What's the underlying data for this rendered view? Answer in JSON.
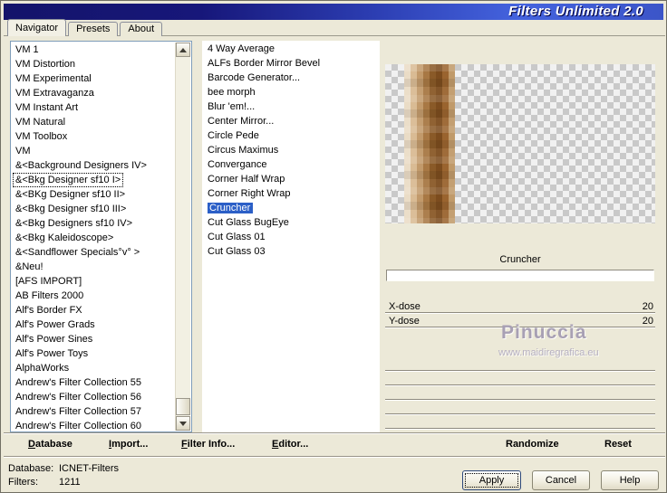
{
  "window": {
    "title": "Filters Unlimited 2.0"
  },
  "tabs": {
    "items": [
      "Navigator",
      "Presets",
      "About"
    ],
    "active_index": 0
  },
  "navigator": {
    "categories": [
      "VM 1",
      "VM Distortion",
      "VM Experimental",
      "VM Extravaganza",
      "VM Instant Art",
      "VM Natural",
      "VM Toolbox",
      "VM",
      "&<Background Designers IV>",
      "&<Bkg Designer sf10 I>",
      "&<BKg Designer sf10 II>",
      "&<Bkg Designer sf10 III>",
      "&<Bkg Designers sf10 IV>",
      "&<Bkg Kaleidoscope>",
      "&<Sandflower Specials°v° >",
      "&Neu!",
      "[AFS IMPORT]",
      "AB Filters 2000",
      "Alf's Border FX",
      "Alf's Power Grads",
      "Alf's Power Sines",
      "Alf's Power Toys",
      "AlphaWorks",
      "Andrew's Filter Collection 55",
      "Andrew's Filter Collection 56",
      "Andrew's Filter Collection 57",
      "Andrew's Filter Collection 60"
    ],
    "selected_category_index": 9,
    "filters": [
      "4 Way Average",
      "ALFs Border Mirror Bevel",
      "Barcode Generator...",
      "bee morph",
      "Blur 'em!...",
      "Center Mirror...",
      "Circle Pede",
      "Circus Maximus",
      "Convergance",
      "Corner Half Wrap",
      "Corner Right Wrap",
      "Cruncher",
      "Cut Glass  BugEye",
      "Cut Glass 01",
      "Cut Glass 03"
    ],
    "selected_filter_index": 11
  },
  "preview": {
    "filter_name": "Cruncher",
    "params": [
      {
        "label": "X-dose",
        "value": "20"
      },
      {
        "label": "Y-dose",
        "value": "20"
      }
    ],
    "watermark_line1": "Pinuccia",
    "watermark_line2": "www.maidiregrafica.eu"
  },
  "toolbar": {
    "database": "Database",
    "import": "Import...",
    "filter_info": "Filter Info...",
    "editor": "Editor...",
    "randomize": "Randomize",
    "reset": "Reset"
  },
  "status": {
    "database_label": "Database:",
    "database_value": "ICNET-Filters",
    "filters_label": "Filters:",
    "filters_value": "1211"
  },
  "actions": {
    "apply": "Apply",
    "cancel": "Cancel",
    "help": "Help"
  },
  "colors": {
    "background": "#ece9d8",
    "selection_blue": "#2b5fc7",
    "titlebar_left": "#14146a",
    "titlebar_right": "#4463de"
  }
}
